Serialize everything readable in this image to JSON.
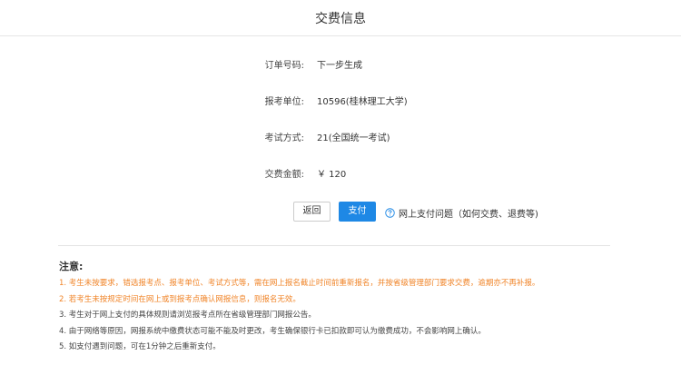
{
  "header": {
    "title": "交费信息"
  },
  "info": [
    {
      "label": "订单号码:",
      "value": "下一步生成"
    },
    {
      "label": "报考单位:",
      "value": "10596(桂林理工大学)"
    },
    {
      "label": "考试方式:",
      "value": "21(全国统一考试)"
    },
    {
      "label": "交费金额:",
      "value": "￥ 120"
    }
  ],
  "buttons": {
    "back": "返回",
    "pay": "支付"
  },
  "help": {
    "icon": "question-circle-icon",
    "text": "网上支付问题（如何交费、退费等)",
    "color": "#1e88e5"
  },
  "notice": {
    "title": "注意:",
    "items": [
      "1. 考生未按要求，错选报考点、报考单位、考试方式等，需在网上报名截止时间前重新报名，并按省级管理部门要求交费，逾期亦不再补报。",
      "2. 若考生未按规定时间在网上或到报考点确认网报信息，则报名无效。",
      "3. 考生对于网上支付的具体规则请浏览报考点所在省级管理部门网报公告。",
      "4. 由于网络等原因，网报系统中缴费状态可能不能及时更改，考生确保银行卡已扣款即可认为缴费成功，不会影响网上确认。",
      "5. 如支付遇到问题，可在1分钟之后重新支付。"
    ]
  },
  "colors": {
    "primary": "#1e88e5",
    "warning": "#f0852a"
  }
}
